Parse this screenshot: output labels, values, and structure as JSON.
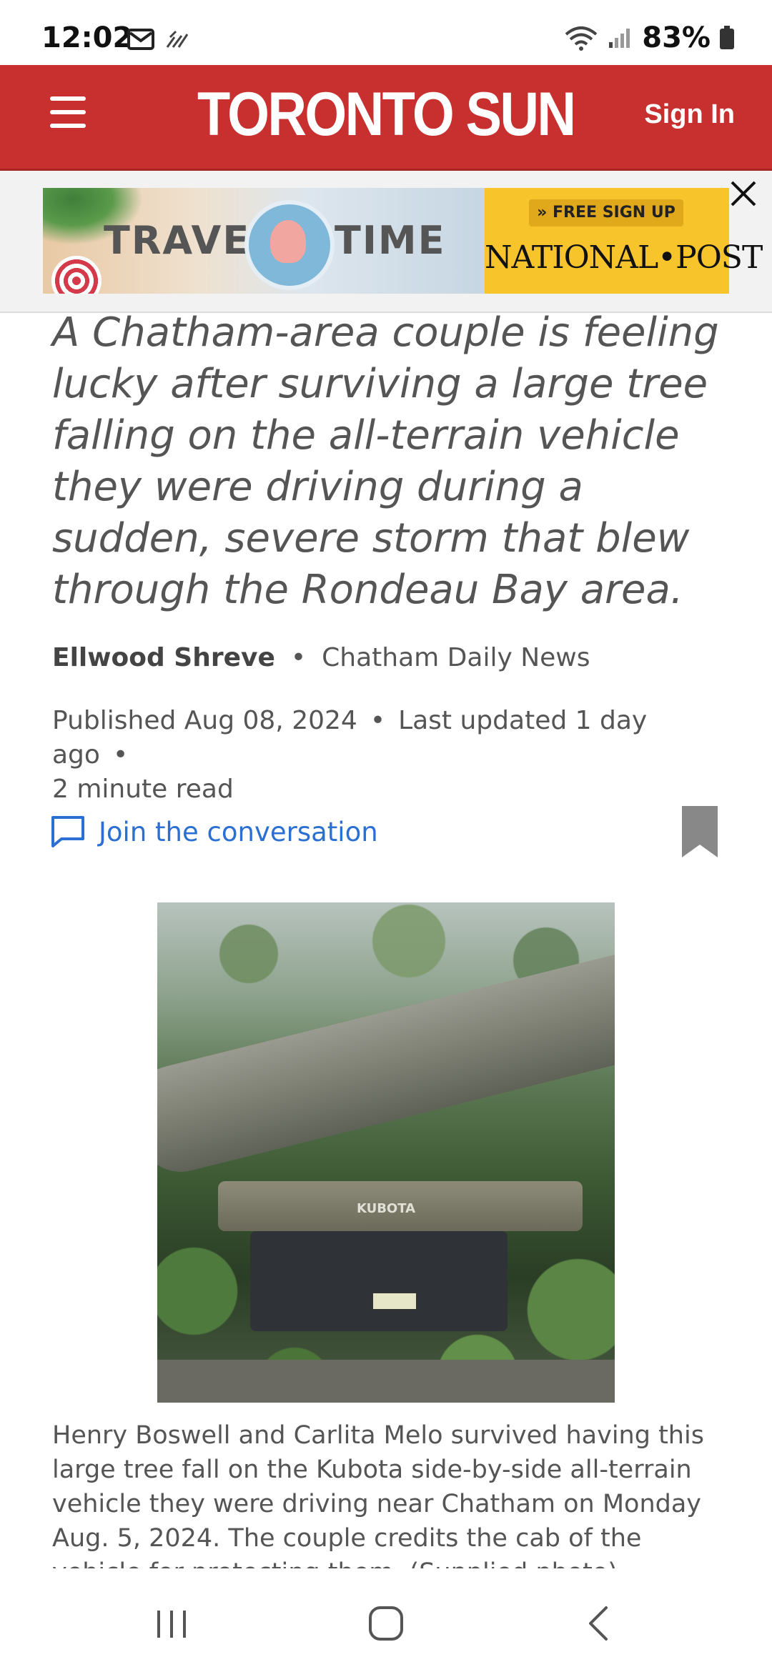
{
  "status_bar": {
    "time": "12:02",
    "battery": "83%",
    "icons": [
      "mail-icon",
      "data-icon",
      "wifi-icon",
      "signal-icon",
      "battery-icon"
    ]
  },
  "header": {
    "logo": "TORONTO SUN",
    "sign_in": "Sign In",
    "brand_color": "#c8302f"
  },
  "ad": {
    "left_word1": "TRAVEL",
    "left_word2": "TIME",
    "cta": "» FREE SIGN UP",
    "publisher": "NATIONAL•POST"
  },
  "article": {
    "dek": "A Chatham-area couple is feeling lucky after surviving a large tree falling on the all-terrain vehicle they were driving during a sudden, severe storm that blew through the Rondeau Bay area.",
    "author": "Ellwood Shreve",
    "source": "Chatham Daily News",
    "published": "Published Aug 08, 2024",
    "updated": "Last updated 1 day ago",
    "read_time": "2 minute read",
    "conversation_label": "Join the conversation",
    "photo_text": "KUBOTA",
    "photo_caption": "Henry Boswell and Carlita Melo survived having this large tree fall on the Kubota side-by-side all-terrain vehicle they were driving near Chatham on Monday Aug. 5, 2024. The couple credits the cab of the vehicle for protecting them. (Supplied photo)"
  },
  "nav_bar": {
    "buttons": [
      "recents-icon",
      "home-icon",
      "back-icon"
    ]
  }
}
